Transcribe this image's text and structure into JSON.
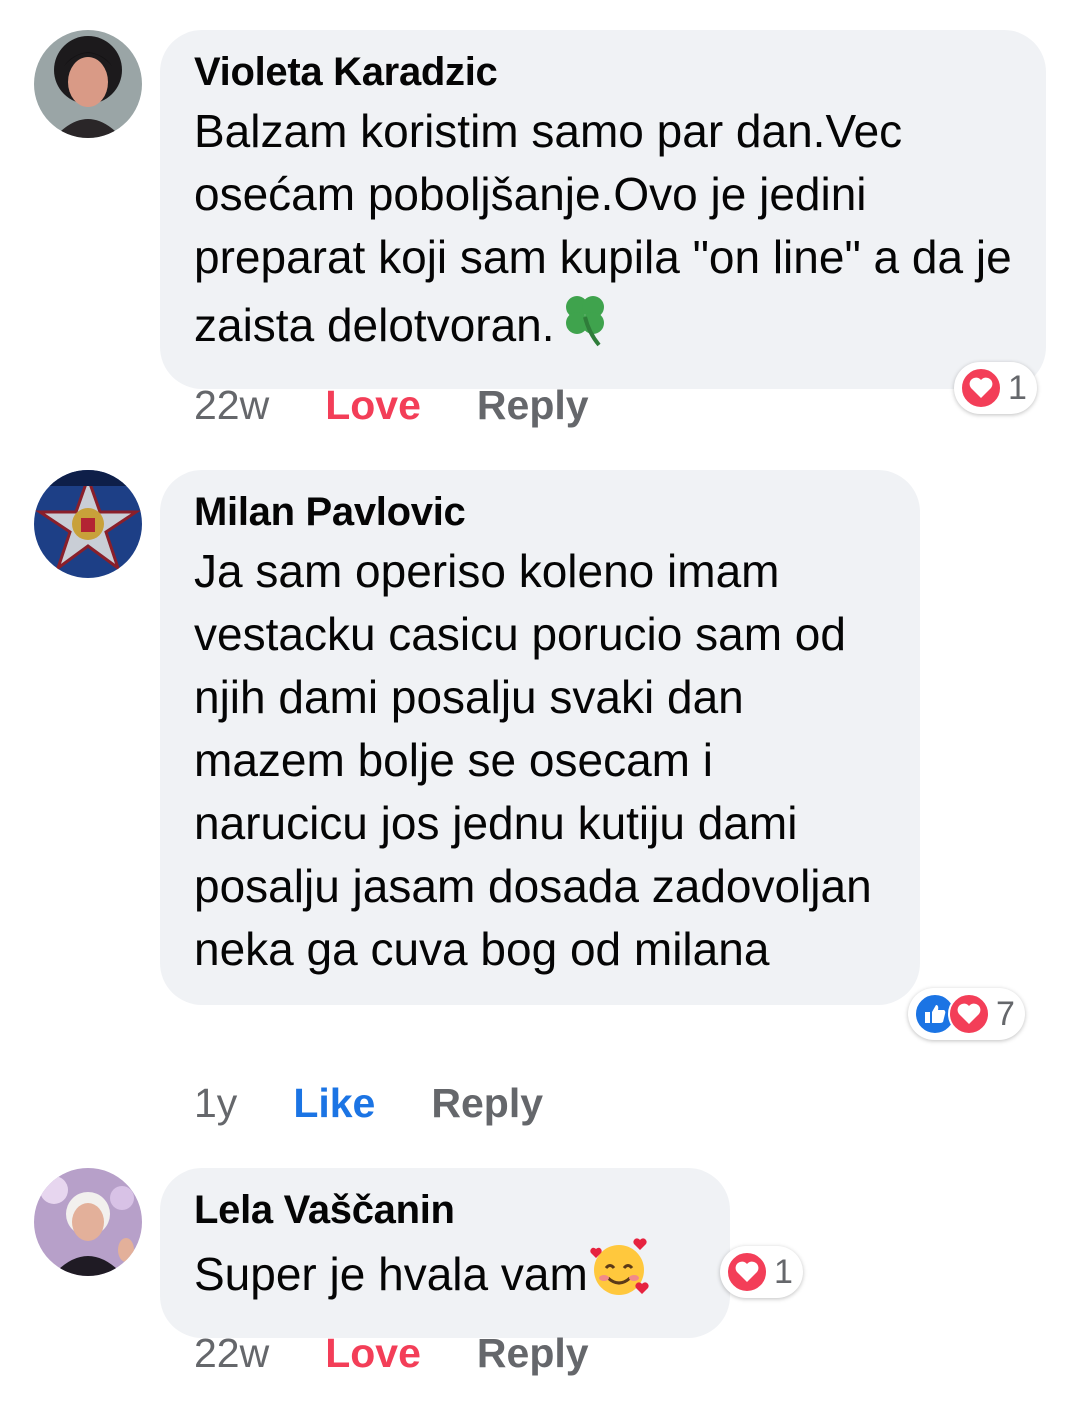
{
  "comments": [
    {
      "author": "Violeta Karadzic",
      "text": "Balzam  koristim samo par dan.Vec osećam poboljšanje.Ovo je jedini preparat koji sam kupila \"on line\" a da je zaista delotvoran.",
      "time": "22w",
      "reaction_label": "Love",
      "reply_label": "Reply",
      "reaction_count": "1",
      "reaction_icons": [
        "heart-icon"
      ],
      "trailing_emoji": "four-leaf-clover-emoji"
    },
    {
      "author": "Milan Pavlovic",
      "text": "Ja sam operiso koleno imam vestacku casicu porucio sam od njih dami posalju svaki dan mazem bolje se osecam i narucicu jos jednu kutiju dami posalju jasam dosada zadovoljan neka ga cuva bog od milana",
      "time": "1y",
      "reaction_label": "Like",
      "reply_label": "Reply",
      "reaction_count": "7",
      "reaction_icons": [
        "thumbs-up-icon",
        "heart-icon"
      ]
    },
    {
      "author": "Lela Vaščanin",
      "text": "Super je hvala vam",
      "time": "22w",
      "reaction_label": "Love",
      "reply_label": "Reply",
      "reaction_count": "1",
      "reaction_icons": [
        "heart-icon"
      ],
      "trailing_emoji": "smiling-face-with-hearts-emoji"
    }
  ],
  "colors": {
    "bubble": "#f0f2f5",
    "love": "#f33e58",
    "like": "#1b74e4",
    "meta": "#65676b"
  }
}
